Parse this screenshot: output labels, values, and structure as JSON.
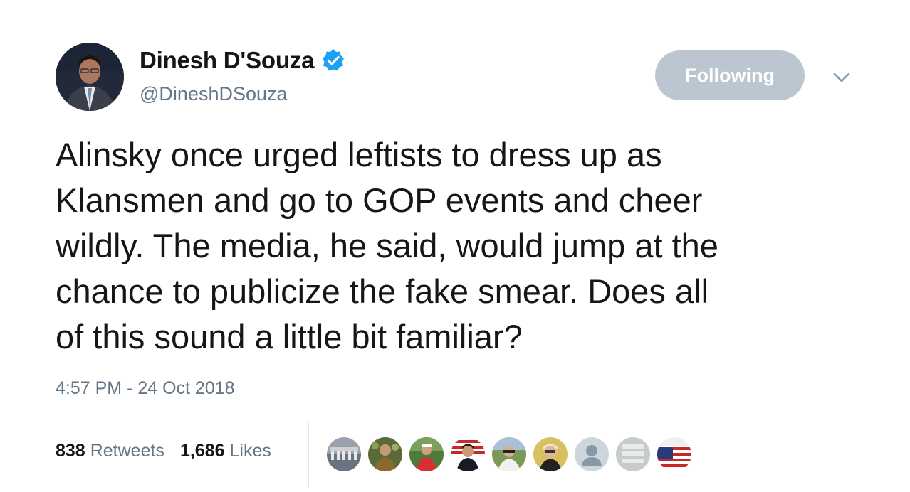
{
  "tweet": {
    "display_name": "Dinesh D'Souza",
    "handle": "@DineshDSouza",
    "verified_icon": "verified-badge-icon",
    "follow_label": "Following",
    "menu_icon": "chevron-down-icon",
    "text": "Alinsky once urged leftists to dress up as\nKlansmen and go to GOP events and cheer\nwildly. The media, he said, would jump at the\nchance to publicize the fake smear. Does all\nof this sound a little bit familiar?",
    "timestamp": "4:57 PM - 24 Oct 2018",
    "retweets_count": "838",
    "retweets_label": "Retweets",
    "likes_count": "1,686",
    "likes_label": "Likes"
  },
  "colors": {
    "follow_button": "#bcc6d0",
    "verified": "#1da1f2",
    "secondary_text": "#657786"
  }
}
